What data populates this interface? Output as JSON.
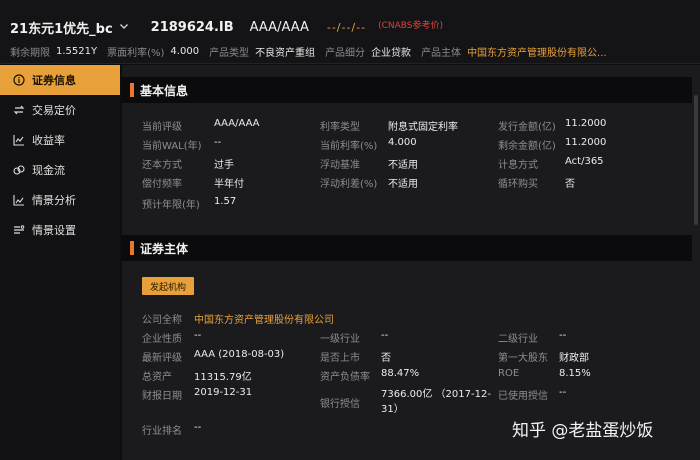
{
  "header": {
    "title": "21东元1优先_bc",
    "code": "2189624.IB",
    "rating": "AAA/AAA",
    "pending": "--/--/--",
    "note": "(CNABS参考价)",
    "row2": [
      {
        "label": "剩余期限",
        "value": "1.5521Y"
      },
      {
        "label": "票面利率(%)",
        "value": "4.000"
      },
      {
        "label": "产品类型",
        "value": "不良资产重组"
      },
      {
        "label": "产品细分",
        "value": "企业贷款"
      },
      {
        "label": "产品主体",
        "value": "中国东方资产管理股份有限公..."
      }
    ]
  },
  "sidebar": {
    "items": [
      {
        "label": "证券信息",
        "icon": "info-circle-icon"
      },
      {
        "label": "交易定价",
        "icon": "exchange-icon"
      },
      {
        "label": "收益率",
        "icon": "line-chart-icon"
      },
      {
        "label": "现金流",
        "icon": "cash-flow-icon"
      },
      {
        "label": "情景分析",
        "icon": "analysis-chart-icon"
      },
      {
        "label": "情景设置",
        "icon": "settings-list-icon"
      }
    ],
    "active_index": 0
  },
  "basic": {
    "title": "基本信息",
    "fields": [
      {
        "label": "当前评级",
        "value": "AAA/AAA"
      },
      {
        "label": "利率类型",
        "value": "附息式固定利率"
      },
      {
        "label": "发行金额(亿)",
        "value": "11.2000"
      },
      {
        "label": "当前WAL(年)",
        "value": "--"
      },
      {
        "label": "当前利率(%)",
        "value": "4.000"
      },
      {
        "label": "剩余金额(亿)",
        "value": "11.2000"
      },
      {
        "label": "还本方式",
        "value": "过手"
      },
      {
        "label": "浮动基准",
        "value": "不适用"
      },
      {
        "label": "计息方式",
        "value": "Act/365"
      },
      {
        "label": "偿付频率",
        "value": "半年付"
      },
      {
        "label": "浮动利差(%)",
        "value": "不适用"
      },
      {
        "label": "循环购买",
        "value": "否"
      },
      {
        "label": "预计年限(年)",
        "value": "1.57"
      }
    ]
  },
  "entity": {
    "title": "证券主体",
    "button": "发起机构",
    "company_label": "公司全称",
    "company_value": "中国东方资产管理股份有限公司",
    "fields": [
      {
        "label": "企业性质",
        "value": "--"
      },
      {
        "label": "一级行业",
        "value": "--"
      },
      {
        "label": "二级行业",
        "value": "--"
      },
      {
        "label": "最新评级",
        "value": "AAA  (2018-08-03)"
      },
      {
        "label": "是否上市",
        "value": "否"
      },
      {
        "label": "第一大股东",
        "value": "财政部"
      },
      {
        "label": "总资产",
        "value": "11315.79亿"
      },
      {
        "label": "资产负债率",
        "value": "88.47%"
      },
      {
        "label": "ROE",
        "value": "8.15%"
      },
      {
        "label": "财报日期",
        "value": "2019-12-31"
      },
      {
        "label": "银行授信",
        "value": "7366.00亿 （2017-12-31）"
      },
      {
        "label": "已使用授信",
        "value": "--"
      },
      {
        "label": "行业排名",
        "value": "--"
      }
    ]
  },
  "watermark": "知乎 @老盐蛋炒饭",
  "colors": {
    "accent": "#e8a13a",
    "section_accent": "#e8772a",
    "note_red": "#e0403a"
  }
}
